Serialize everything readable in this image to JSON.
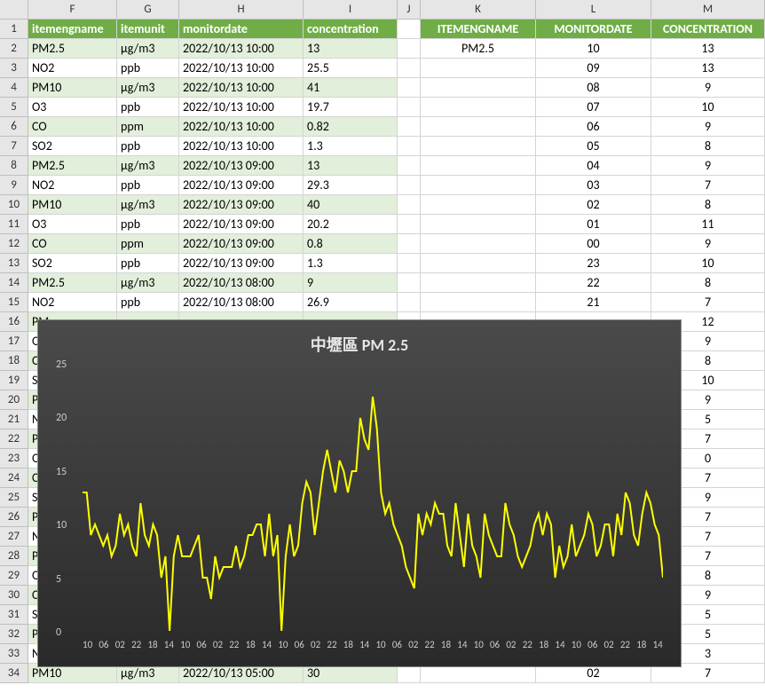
{
  "columns": [
    "F",
    "G",
    "H",
    "I",
    "J",
    "K",
    "L",
    "M"
  ],
  "left_headers": {
    "F": "itemengname",
    "G": "itemunit",
    "H": "monitordate",
    "I": "concentration"
  },
  "right_headers": {
    "K": "ITEMENGNAME",
    "L": "MONITORDATE",
    "M": "CONCENTRATION"
  },
  "left_rows_full": [
    {
      "F": "PM2.5",
      "G": "μg/m3",
      "H": "2022/10/13 10:00",
      "I": "13"
    },
    {
      "F": "NO2",
      "G": "ppb",
      "H": "2022/10/13 10:00",
      "I": "25.5"
    },
    {
      "F": "PM10",
      "G": "μg/m3",
      "H": "2022/10/13 10:00",
      "I": "41"
    },
    {
      "F": "O3",
      "G": "ppb",
      "H": "2022/10/13 10:00",
      "I": "19.7"
    },
    {
      "F": "CO",
      "G": "ppm",
      "H": "2022/10/13 10:00",
      "I": "0.82"
    },
    {
      "F": "SO2",
      "G": "ppb",
      "H": "2022/10/13 10:00",
      "I": "1.3"
    },
    {
      "F": "PM2.5",
      "G": "μg/m3",
      "H": "2022/10/13 09:00",
      "I": "13"
    },
    {
      "F": "NO2",
      "G": "ppb",
      "H": "2022/10/13 09:00",
      "I": "29.3"
    },
    {
      "F": "PM10",
      "G": "μg/m3",
      "H": "2022/10/13 09:00",
      "I": "40"
    },
    {
      "F": "O3",
      "G": "ppb",
      "H": "2022/10/13 09:00",
      "I": "20.2"
    },
    {
      "F": "CO",
      "G": "ppm",
      "H": "2022/10/13 09:00",
      "I": "0.8"
    },
    {
      "F": "SO2",
      "G": "ppb",
      "H": "2022/10/13 09:00",
      "I": "1.3"
    },
    {
      "F": "PM2.5",
      "G": "μg/m3",
      "H": "2022/10/13 08:00",
      "I": "9"
    },
    {
      "F": "NO2",
      "G": "ppb",
      "H": "2022/10/13 08:00",
      "I": "26.9"
    }
  ],
  "left_rows_partial_prefix": [
    "PM",
    "O3",
    "CO",
    "SO",
    "PM",
    "NO",
    "PM",
    "O3",
    "CO",
    "SO",
    "PM",
    "NO",
    "PM",
    "O3",
    "CO",
    "SO",
    "PM",
    "NO",
    "PM10"
  ],
  "left_row_34": {
    "F": "PM10",
    "G": "μg/m3",
    "H": "2022/10/13 05:00",
    "I": "30"
  },
  "right_first": {
    "K": "PM2.5",
    "L": "10",
    "M": "13"
  },
  "right_rows_LM": [
    {
      "L": "09",
      "M": "13"
    },
    {
      "L": "08",
      "M": "9"
    },
    {
      "L": "07",
      "M": "10"
    },
    {
      "L": "06",
      "M": "9"
    },
    {
      "L": "05",
      "M": "8"
    },
    {
      "L": "04",
      "M": "9"
    },
    {
      "L": "03",
      "M": "7"
    },
    {
      "L": "02",
      "M": "8"
    },
    {
      "L": "01",
      "M": "11"
    },
    {
      "L": "00",
      "M": "9"
    },
    {
      "L": "23",
      "M": "10"
    },
    {
      "L": "22",
      "M": "8"
    },
    {
      "L": "21",
      "M": "7"
    },
    {
      "L": "",
      "M": "12"
    },
    {
      "L": "",
      "M": "9"
    },
    {
      "L": "",
      "M": "8"
    },
    {
      "L": "",
      "M": "10"
    },
    {
      "L": "",
      "M": "9"
    },
    {
      "L": "",
      "M": "5"
    },
    {
      "L": "",
      "M": "7"
    },
    {
      "L": "",
      "M": "0"
    },
    {
      "L": "",
      "M": "7"
    },
    {
      "L": "",
      "M": "9"
    },
    {
      "L": "",
      "M": "7"
    },
    {
      "L": "",
      "M": "7"
    },
    {
      "L": "",
      "M": "7"
    },
    {
      "L": "",
      "M": "8"
    },
    {
      "L": "",
      "M": "9"
    },
    {
      "L": "",
      "M": "5"
    },
    {
      "L": "",
      "M": "5"
    },
    {
      "L": "",
      "M": "3"
    },
    {
      "L": "02",
      "M": "7"
    }
  ],
  "chart_data": {
    "type": "line",
    "title": "中壢區 PM 2.5",
    "ylabel": "",
    "xlabel": "",
    "ylim": [
      0,
      25
    ],
    "yticks": [
      0,
      5,
      10,
      15,
      20,
      25
    ],
    "xticks": [
      "10",
      "06",
      "02",
      "22",
      "18",
      "14",
      "10",
      "06",
      "02",
      "22",
      "18",
      "14",
      "10",
      "06",
      "02",
      "22",
      "18",
      "14",
      "10",
      "06",
      "02",
      "22",
      "18",
      "14",
      "10",
      "06",
      "02",
      "22",
      "18",
      "14",
      "10",
      "06",
      "02",
      "22",
      "18",
      "14"
    ],
    "values": [
      13,
      13,
      9,
      10,
      9,
      8,
      9,
      7,
      8,
      11,
      9,
      10,
      8,
      7,
      12,
      9,
      8,
      10,
      9,
      5,
      7,
      0,
      7,
      9,
      7,
      7,
      7,
      8,
      9,
      5,
      5,
      3,
      7,
      5,
      6,
      6,
      6,
      8,
      6,
      7,
      9,
      9,
      10,
      10,
      7,
      11,
      7,
      9,
      0,
      7,
      10,
      7,
      8,
      12,
      14,
      13,
      9,
      12,
      15,
      17,
      15,
      13,
      16,
      15,
      13,
      15,
      15,
      20,
      18,
      17,
      22,
      19,
      13,
      11,
      12,
      10,
      9,
      8,
      6,
      5,
      4,
      11,
      9,
      11,
      10,
      12,
      11,
      11,
      8,
      7,
      12,
      9,
      6,
      11,
      8,
      7,
      5,
      11,
      9,
      8,
      7,
      7,
      12,
      10,
      9,
      7,
      6,
      7,
      8,
      10,
      11,
      9,
      11,
      10,
      5,
      8,
      6,
      7,
      10,
      7,
      8,
      9,
      11,
      10,
      7,
      8,
      10,
      10,
      7,
      11,
      9,
      13,
      12,
      9,
      8,
      11,
      13,
      12,
      10,
      9,
      5
    ]
  }
}
